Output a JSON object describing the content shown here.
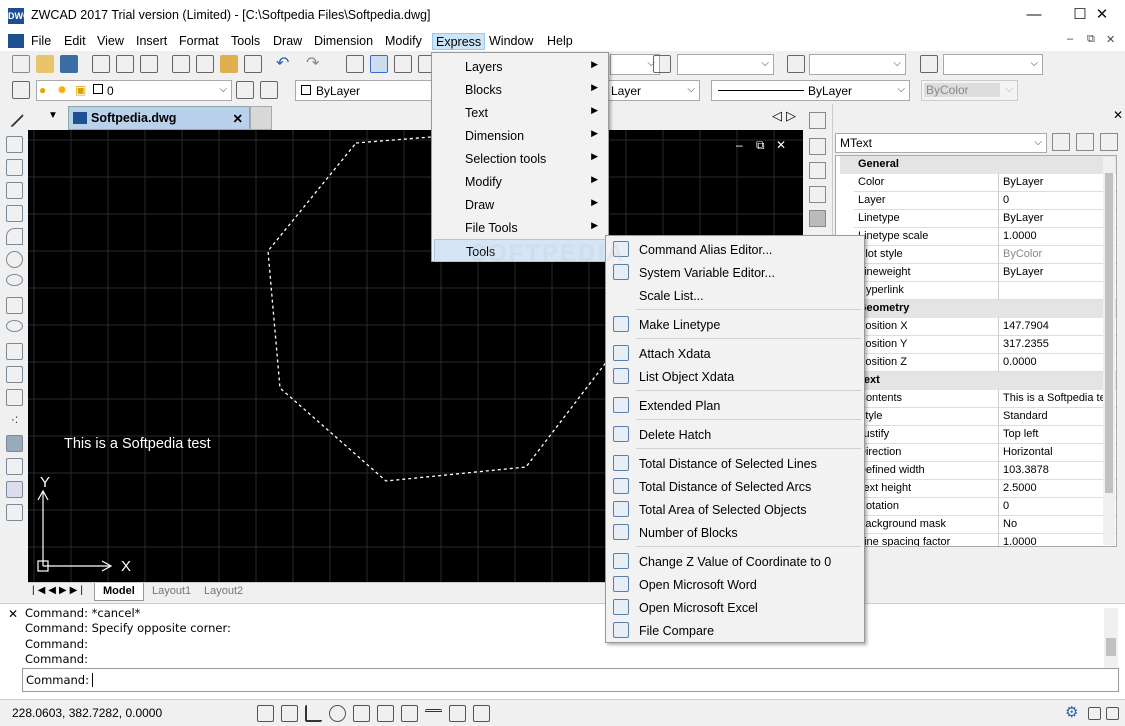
{
  "window": {
    "title": "ZWCAD 2017 Trial version (Limited) - [C:\\Softpedia Files\\Softpedia.dwg]",
    "logo": "DWG",
    "min": "—",
    "max": "☐",
    "close": "✕"
  },
  "menu": [
    "File",
    "Edit",
    "View",
    "Insert",
    "Format",
    "Tools",
    "Draw",
    "Dimension",
    "Modify",
    "Express",
    "Window",
    "Help"
  ],
  "toolbar2": {
    "layer_value": "0",
    "color_value": "ByLayer",
    "layer2_value": "Layer",
    "linetype_value": "ByLayer",
    "bycolor_value": "ByColor"
  },
  "doc_tab": {
    "label": "Softpedia.dwg",
    "close": "✕"
  },
  "canvas": {
    "text": "This is a Softpedia test",
    "axis_x": "X",
    "axis_y": "Y",
    "ctrl_min": "‒",
    "ctrl_restore": "⧉",
    "ctrl_close": "✕"
  },
  "layout_tabs": [
    "Model",
    "Layout1",
    "Layout2"
  ],
  "command_lines": [
    "Command: *cancel*",
    "Command: Specify opposite corner:",
    "Command:",
    "Command:"
  ],
  "command_prompt": "Command:",
  "status": {
    "coords": "228.0603, 382.7282, 0.0000"
  },
  "properties": {
    "selected": "MText",
    "categories": [
      {
        "name": "General",
        "rows": [
          [
            "Color",
            "ByLayer"
          ],
          [
            "Layer",
            "0"
          ],
          [
            "Linetype",
            "ByLayer"
          ],
          [
            "Linetype scale",
            "1.0000"
          ],
          [
            "Plot style",
            "ByColor"
          ],
          [
            "Lineweight",
            "ByLayer"
          ],
          [
            "Hyperlink",
            ""
          ]
        ]
      },
      {
        "name": "Geometry",
        "rows": [
          [
            "Position X",
            "147.7904"
          ],
          [
            "Position Y",
            "317.2355"
          ],
          [
            "Position Z",
            "0.0000"
          ]
        ]
      },
      {
        "name": "Text",
        "rows": [
          [
            "Contents",
            "This is a Softpedia test"
          ],
          [
            "Style",
            "Standard"
          ],
          [
            "Justify",
            "Top left"
          ],
          [
            "Direction",
            "Horizontal"
          ],
          [
            "Defined width",
            "103.3878"
          ],
          [
            "Text height",
            "2.5000"
          ],
          [
            "Rotation",
            "0"
          ],
          [
            "Background mask",
            "No"
          ],
          [
            "Line spacing factor",
            "1.0000"
          ]
        ]
      }
    ]
  },
  "express_menu": [
    "Layers",
    "Blocks",
    "Text",
    "Dimension",
    "Selection tools",
    "Modify",
    "Draw",
    "File Tools",
    "Tools"
  ],
  "tools_menu": [
    [
      "Command Alias Editor...",
      "System Variable Editor...",
      "Scale List..."
    ],
    [
      "Make Linetype"
    ],
    [
      "Attach Xdata",
      "List Object Xdata"
    ],
    [
      "Extended Plan"
    ],
    [
      "Delete Hatch"
    ],
    [
      "Total Distance of Selected Lines",
      "Total Distance of Selected Arcs",
      "Total Area of Selected Objects",
      "Number of Blocks"
    ],
    [
      "Change Z Value of Coordinate to 0",
      "Open Microsoft Word",
      "Open Microsoft Excel",
      "File Compare"
    ]
  ],
  "watermark": "SOFTPEDIA"
}
